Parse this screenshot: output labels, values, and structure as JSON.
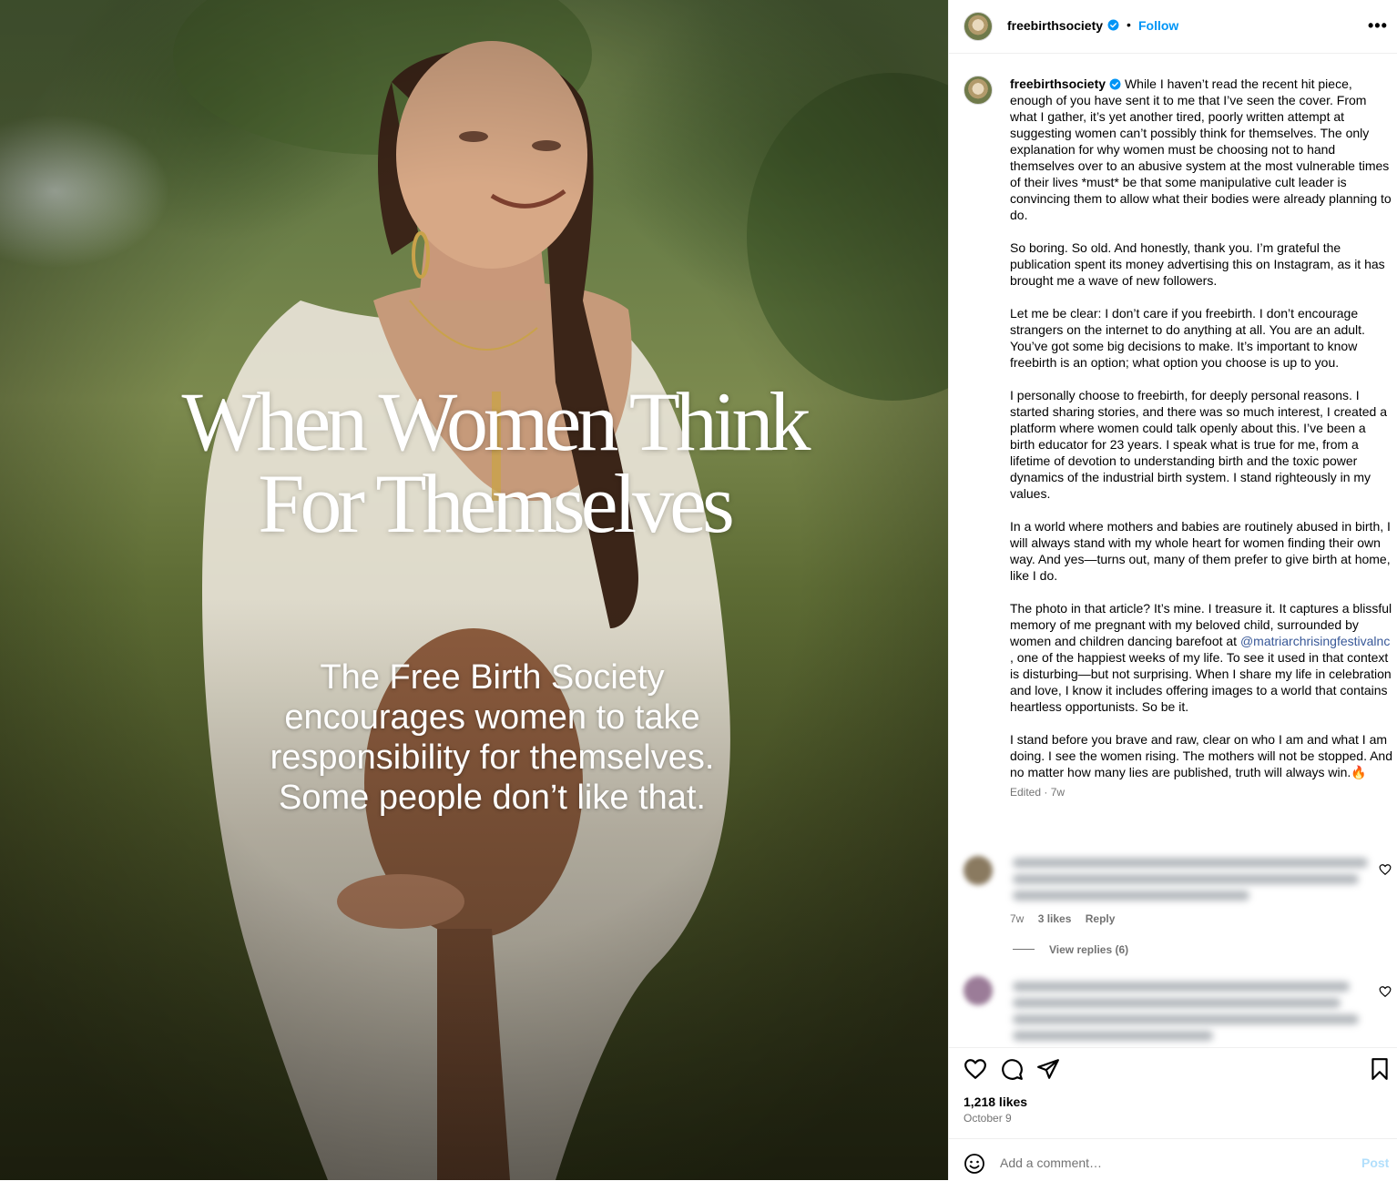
{
  "post_image": {
    "headline_lines": [
      "When Women Think",
      "For Themselves"
    ],
    "subline_lines": [
      "The Free Birth Society",
      "encourages women to take",
      "responsibility for themselves.",
      "Some people don’t like that."
    ]
  },
  "header": {
    "username": "freebirthsociety",
    "dot": "•",
    "follow_label": "Follow",
    "more_label": "•••"
  },
  "caption": {
    "username": "freebirthsociety",
    "paragraphs": [
      "While I haven’t read the recent hit piece, enough of you have sent it to me that I’ve seen the cover. From what I gather, it’s yet another tired, poorly written attempt at suggesting women can’t possibly think for themselves. The only explanation for why women must be choosing not to hand themselves over to an abusive system at the most vulnerable times of their lives *must* be that some manipulative cult leader is convincing them to allow what their bodies were already planning to do.",
      "So boring. So old. And honestly, thank you. I’m grateful the publication spent its money advertising this on Instagram, as it has brought me a wave of new followers.",
      "Let me be clear: I don’t care if you freebirth. I don’t encourage strangers on the internet to do anything at all. You are an adult. You’ve got some big decisions to make. It’s important to know freebirth is an option; what option you choose is up to you.",
      "I personally choose to freebirth, for deeply personal reasons. I started sharing stories, and there was so much interest, I created a platform where women could talk openly about this. I’ve been a birth educator for 23 years. I speak what is true for me, from a lifetime of devotion to understanding birth and the toxic power dynamics of the industrial birth system. I stand righteously in my values.",
      "In a world where mothers and babies are routinely abused in birth, I will always stand with my whole heart for women finding their own way. And yes—turns out, many of them prefer to give birth at home, like I do."
    ],
    "p6_before": "The photo in that article? It’s mine. I treasure it. It captures a blissful memory of me pregnant with my beloved child, surrounded by women and children dancing barefoot at ",
    "p6_mention": "@matriarchrisingfestivalnc",
    "p6_after": " , one of the happiest weeks of my life. To see it used in that context is disturbing—but not surprising. When I share my life in celebration and love, I know it includes offering images to a world that contains heartless opportunists. So be it.",
    "p7": "I stand before you brave and raw, clear on who I am and what I am doing. I see the women rising. The mothers will not be stopped. And no matter how many lies are published, truth will always win.",
    "p7_emoji": "🔥",
    "meta": "Edited · 7w"
  },
  "comments": [
    {
      "age": "7w",
      "likes": "3 likes",
      "reply_label": "Reply"
    }
  ],
  "view_replies": "View replies (6)",
  "likes": "1,218 likes",
  "date": "October 9",
  "add_comment": {
    "placeholder": "Add a comment…",
    "post_label": "Post"
  },
  "colors": {
    "accent": "#0095f6",
    "mention": "#385898",
    "muted": "#737373",
    "post_disabled": "#b2dffc"
  }
}
